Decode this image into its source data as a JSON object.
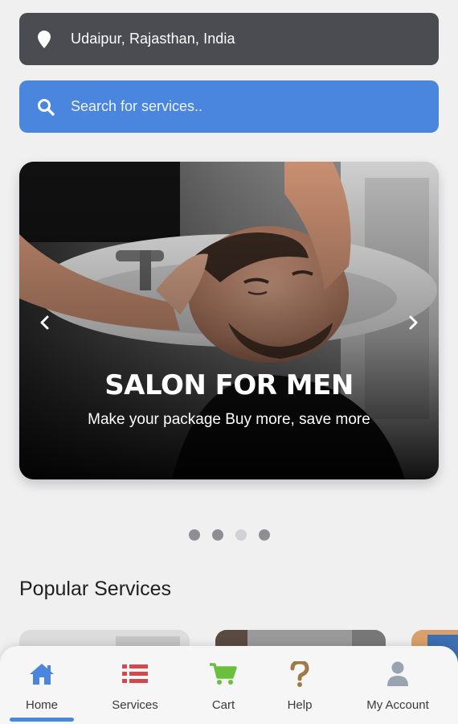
{
  "location": {
    "text": "Udaipur, Rajasthan, India",
    "icon": "map-pin-icon"
  },
  "search": {
    "placeholder": "Search for services..",
    "icon": "search-icon"
  },
  "banner": {
    "title": "SALON FOR MEN",
    "subtitle": "Make your package Buy more, save more",
    "prev_icon": "chevron-left-icon",
    "next_icon": "chevron-right-icon",
    "slide_count": 4,
    "active_slide": 3
  },
  "popular": {
    "title": "Popular Services"
  },
  "nav": {
    "items": [
      {
        "label": "Home",
        "icon": "home-icon",
        "color": "#4a86dd",
        "active": true
      },
      {
        "label": "Services",
        "icon": "list-icon",
        "color": "#d8454b"
      },
      {
        "label": "Cart",
        "icon": "cart-icon",
        "color": "#6bbf3c"
      },
      {
        "label": "Help",
        "icon": "question-icon",
        "color": "#a07a45"
      },
      {
        "label": "My Account",
        "icon": "user-icon",
        "color": "#9aa3b0"
      }
    ]
  },
  "colors": {
    "location_bg": "#4a4c52",
    "search_bg": "#4a86dd",
    "accent": "#4a86dd"
  }
}
